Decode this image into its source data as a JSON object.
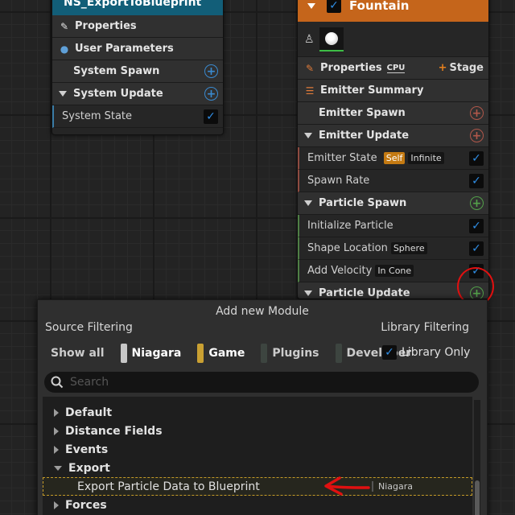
{
  "system_node": {
    "title": "NS_ExportToBlueprint",
    "rows": {
      "properties": "Properties",
      "user_parameters": "User Parameters",
      "system_spawn": "System Spawn",
      "system_update": "System Update",
      "system_state": "System State"
    }
  },
  "emitter_node": {
    "title": "Fountain",
    "properties": "Properties",
    "cpu_label": "CPU",
    "stage_label": "Stage",
    "emitter_summary": "Emitter Summary",
    "emitter_spawn": "Emitter Spawn",
    "emitter_update": "Emitter Update",
    "emitter_state": "Emitter State",
    "emitter_state_tag_self": "Self",
    "emitter_state_tag_infinite": "Infinite",
    "spawn_rate": "Spawn Rate",
    "particle_spawn": "Particle Spawn",
    "initialize_particle": "Initialize Particle",
    "shape_location": "Shape Location",
    "shape_location_tag": "Sphere",
    "add_velocity": "Add Velocity",
    "add_velocity_tag": "In Cone",
    "particle_update": "Particle Update"
  },
  "popup": {
    "title": "Add new Module",
    "source_filtering": "Source Filtering",
    "library_filtering": "Library Filtering",
    "filters": [
      "Show all",
      "Niagara",
      "Game",
      "Plugins",
      "Developer"
    ],
    "library_only": "Library Only",
    "search_placeholder": "Search",
    "tree": {
      "default": "Default",
      "distance_fields": "Distance Fields",
      "events": "Events",
      "export": "Export",
      "export_item": "Export Particle Data to Blueprint",
      "export_item_source": "Niagara",
      "forces": "Forces"
    }
  },
  "colors": {
    "system_title": "#125e78",
    "emitter_title": "#c5651b",
    "annotation": "#e01010",
    "niagara_swatch": "#c7c7c7",
    "game_swatch": "#c9a032"
  }
}
